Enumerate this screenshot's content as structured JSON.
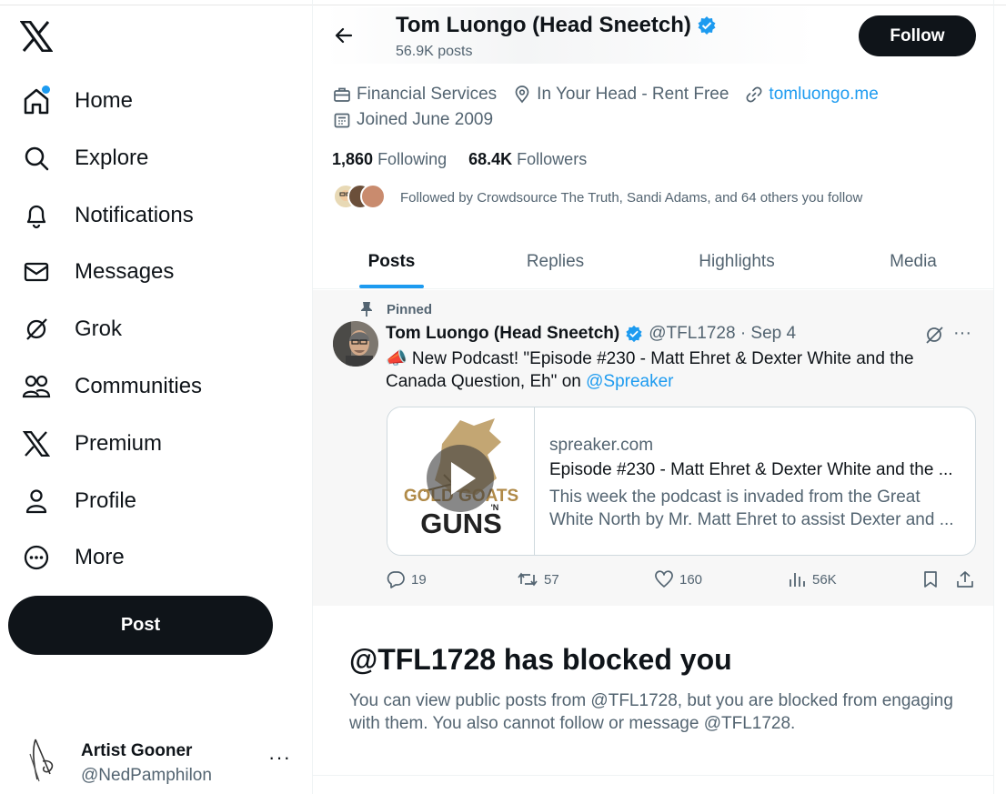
{
  "sidebar": {
    "logo": "x-logo-icon",
    "items": [
      {
        "label": "Home",
        "icon": "home-icon"
      },
      {
        "label": "Explore",
        "icon": "search-icon"
      },
      {
        "label": "Notifications",
        "icon": "bell-icon"
      },
      {
        "label": "Messages",
        "icon": "envelope-icon"
      },
      {
        "label": "Grok",
        "icon": "grok-icon"
      },
      {
        "label": "Communities",
        "icon": "people-icon"
      },
      {
        "label": "Premium",
        "icon": "x-icon"
      },
      {
        "label": "Profile",
        "icon": "person-icon"
      },
      {
        "label": "More",
        "icon": "more-circle-icon"
      }
    ],
    "post_label": "Post",
    "account": {
      "name": "Artist Gooner",
      "handle": "@NedPamphilon",
      "more": "···"
    }
  },
  "profile": {
    "name": "Tom Luongo (Head Sneetch)",
    "post_count": "56.9K posts",
    "follow_label": "Follow",
    "category": "Financial Services",
    "location": "In Your Head - Rent Free",
    "website": "tomluongo.me",
    "joined": "Joined June 2009",
    "following_count": "1,860",
    "following_label": "Following",
    "followers_count": "68.4K",
    "followers_label": "Followers",
    "followed_by": "Followed by Crowdsource The Truth, Sandi Adams, and 64 others you follow"
  },
  "tabs": [
    "Posts",
    "Replies",
    "Highlights",
    "Media"
  ],
  "pinned_post": {
    "pinned_label": "Pinned",
    "author": "Tom Luongo (Head Sneetch)",
    "handle_date": "@TFL1728 · Sep 4",
    "more": "···",
    "text_main": "📣 New Podcast! \"Episode #230 - Matt Ehret & Dexter White and the Canada Question, Eh\" on ",
    "mention": "@Spreaker",
    "card": {
      "image_text_top": "GOLD GOATS",
      "image_text_mid": "'N",
      "image_text_bottom": "GUNS",
      "domain": "spreaker.com",
      "title": "Episode #230 - Matt Ehret & Dexter White and the ...",
      "description": "This week the podcast is invaded from the Great White North by Mr. Matt Ehret to assist Dexter and ..."
    },
    "stats": {
      "replies": "19",
      "reposts": "57",
      "likes": "160",
      "views": "56K"
    }
  },
  "blocked": {
    "title": "@TFL1728 has blocked you",
    "description": "You can view public posts from @TFL1728, but you are blocked from engaging with them. You also cannot follow or message @TFL1728."
  },
  "colors": {
    "accent": "#1d9bf0",
    "text": "#0f1419",
    "muted": "#536471",
    "button": "#0f1419"
  }
}
